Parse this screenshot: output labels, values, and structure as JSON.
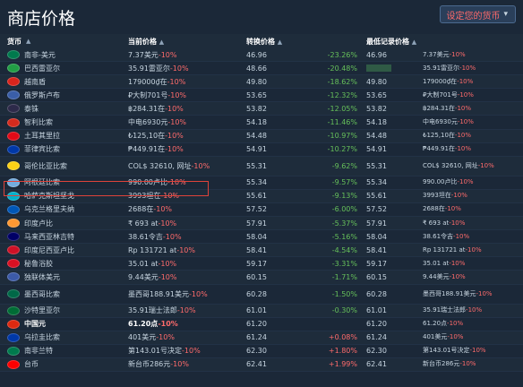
{
  "title": "商店价格",
  "currency_button": "设定您的货币",
  "headers": {
    "currency": "货币",
    "current_price": "当前价格",
    "converted": "转换价格",
    "lowest": "最低记录价格"
  },
  "rows": [
    {
      "name": "南非-美元",
      "flag": "#007a4d",
      "price": "7.37美元-10%",
      "conv": "46.96",
      "pct": "-23.26%",
      "low": "46.96",
      "low_price": "7.37美元-10%"
    },
    {
      "name": "巴西雷亚尔",
      "flag": "#229e45",
      "price": "35.91雷亚尔-10%",
      "conv": "48.66",
      "pct": "-20.48%",
      "low": "",
      "low_price": "35.91雷亚尔-10%"
    },
    {
      "name": "越南盾",
      "flag": "#da251d",
      "price": "179000₫在-10%",
      "conv": "49.80",
      "pct": "-18.62%",
      "low": "49.80",
      "low_price": "179000₫在-10%"
    },
    {
      "name": "俄罗斯卢布",
      "flag": "#3a5ea8",
      "price": "₽大制701号-10%",
      "conv": "53.65",
      "pct": "-12.32%",
      "low": "53.65",
      "low_price": "₽大制701号-10%"
    },
    {
      "name": "泰铢",
      "flag": "#2d2a4a",
      "price": "฿284.31在-10%",
      "conv": "53.82",
      "pct": "-12.05%",
      "low": "53.82",
      "low_price": "฿284.31在-10%"
    },
    {
      "name": "智利比索",
      "flag": "#d52b1e",
      "price": "中电6930元-10%",
      "conv": "54.18",
      "pct": "-11.46%",
      "low": "54.18",
      "low_price": "中电6930元-10%"
    },
    {
      "name": "土耳其里拉",
      "flag": "#e30a17",
      "price": "₺125,10在-10%",
      "conv": "54.48",
      "pct": "-10.97%",
      "low": "54.48",
      "low_price": "₺125,10在-10%"
    },
    {
      "name": "菲律宾比索",
      "flag": "#0038a8",
      "price": "₱449.91在-10%",
      "conv": "54.91",
      "pct": "-10.27%",
      "low": "54.91",
      "low_price": "₱449.91在-10%"
    },
    {
      "name": "哥伦比亚比索",
      "flag": "#fcd116",
      "price": "COL$ 32610, 网址-10%",
      "conv": "55.31",
      "pct": "-9.62%",
      "low": "55.31",
      "low_price": "COL$ 32610, 网址-10%",
      "tall": true
    },
    {
      "name": "阿根廷比索",
      "flag": "#74acdf",
      "price": "990.00卢比-10%",
      "conv": "55.34",
      "pct": "-9.57%",
      "low": "55.34",
      "low_price": "990.00卢比-10%"
    },
    {
      "name": "哈萨克斯坦坚戈",
      "flag": "#00afca",
      "price": "3993坦在-10%",
      "conv": "55.61",
      "pct": "-9.13%",
      "low": "55.61",
      "low_price": "3993坦在-10%"
    },
    {
      "name": "乌克兰格里夫纳",
      "flag": "#0057b7",
      "price": "2688在-10%",
      "conv": "57.52",
      "pct": "-6.00%",
      "low": "57.52",
      "low_price": "2688在-10%"
    },
    {
      "name": "印度卢比",
      "flag": "#ff9933",
      "price": "₹ 693 at-10%",
      "conv": "57.91",
      "pct": "-5.37%",
      "low": "57.91",
      "low_price": "₹ 693 at-10%"
    },
    {
      "name": "马来西亚林吉特",
      "flag": "#010066",
      "price": "38.61令吉-10%",
      "conv": "58.04",
      "pct": "-5.16%",
      "low": "58.04",
      "low_price": "38.61令吉-10%"
    },
    {
      "name": "印度尼西亚卢比",
      "flag": "#ce1126",
      "price": "Rp 131721 at-10%",
      "conv": "58.41",
      "pct": "-4.54%",
      "low": "58.41",
      "low_price": "Rp 131721 at-10%"
    },
    {
      "name": "秘鲁浴胶",
      "flag": "#d91023",
      "price": "35.01 at-10%",
      "conv": "59.17",
      "pct": "-3.31%",
      "low": "59.17",
      "low_price": "35.01 at-10%"
    },
    {
      "name": "独联体美元",
      "flag": "#3c5aa8",
      "price": "9.44美元-10%",
      "conv": "60.15",
      "pct": "-1.71%",
      "low": "60.15",
      "low_price": "9.44美元-10%"
    },
    {
      "name": "墨西哥比索",
      "flag": "#006847",
      "price": "墨西哥188.91美元-10%",
      "conv": "60.28",
      "pct": "-1.50%",
      "low": "60.28",
      "low_price": "墨西哥188.91美元-10%",
      "tall": true
    },
    {
      "name": "沙特里亚尔",
      "flag": "#006c35",
      "price": "35.91瑞士法郎-10%",
      "conv": "61.01",
      "pct": "-0.30%",
      "low": "61.01",
      "low_price": "35.91瑞士法郎-10%"
    },
    {
      "name": "中国元",
      "flag": "#de2910",
      "price": "61.20点-10%",
      "conv": "61.20",
      "pct": "",
      "low": "61.20",
      "low_price": "61.20点-10%",
      "lowest": true
    },
    {
      "name": "乌拉圭比索",
      "flag": "#0038a8",
      "price": "401美元-10%",
      "conv": "61.24",
      "pct": "+0.08%",
      "low": "61.24",
      "low_price": "401美元-10%"
    },
    {
      "name": "南非兰特",
      "flag": "#007a4d",
      "price": "第143.01号决定-10%",
      "conv": "62.30",
      "pct": "+1.80%",
      "low": "62.30",
      "low_price": "第143.01号决定-10%"
    },
    {
      "name": "台币",
      "flag": "#fe0000",
      "price": "新台币286元-10%",
      "conv": "62.41",
      "pct": "+1.99%",
      "low": "62.41",
      "low_price": "新台币286元-10%"
    }
  ]
}
